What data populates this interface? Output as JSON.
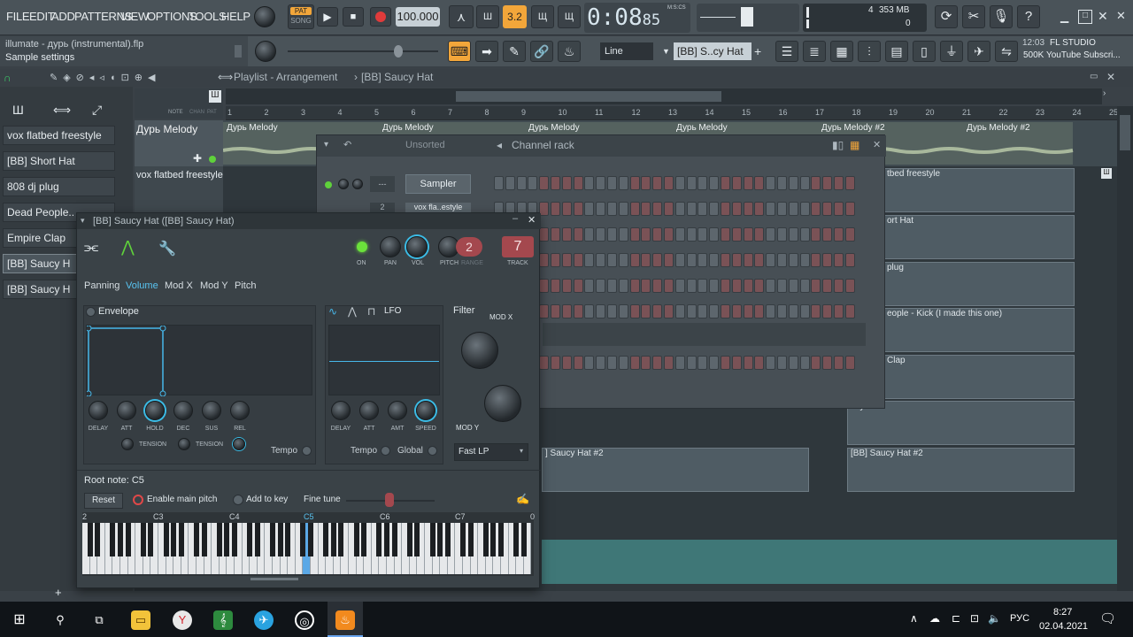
{
  "menu": [
    "FILE",
    "EDIT",
    "ADD",
    "PATTERNS",
    "VIEW",
    "OPTIONS",
    "TOOLS",
    "HELP"
  ],
  "pat_song": {
    "pat": "PAT",
    "song": "SONG"
  },
  "tempo": "100.000",
  "time": "0:08",
  "time_small": "85",
  "time_label": "M:S:CS",
  "pattern_num": "3.2",
  "cpu_value": "4",
  "memory": "353 MB",
  "polyphony": "0",
  "hint": {
    "line1": "illumate - дурь (instrumental).flp",
    "line2": "Sample settings"
  },
  "toolbar": {
    "snap": "Line",
    "channel": "[BB] S..cy Hat",
    "news": {
      "time": "12:03",
      "title": "FL STUDIO",
      "text": "500K YouTube Subscri..."
    }
  },
  "playlist": {
    "title": "Playlist - Arrangement",
    "pattern": "[BB] Saucy Hat"
  },
  "ruler_labels": [
    "NOTE",
    "CHAN",
    "PAT"
  ],
  "ruler": [
    "1",
    "2",
    "3",
    "4",
    "5",
    "6",
    "7",
    "8",
    "9",
    "10",
    "11",
    "12",
    "13",
    "14",
    "15",
    "16",
    "17",
    "18",
    "19",
    "20",
    "21",
    "22",
    "23",
    "24",
    "25"
  ],
  "picker": [
    "vox flatbed freestyle",
    "[BB] Short Hat",
    "808 dj plug",
    "Dead People..",
    "Empire Clap",
    "[BB] Saucy H",
    "[BB] Saucy H"
  ],
  "tracks": {
    "t1": "Дурь Melody",
    "t2": "vox flatbed freestyle"
  },
  "clips": {
    "melody": "Дурь Melody",
    "melody2": "Дурь Melody #2",
    "vox": "tbed freestyle",
    "short": "ort Hat",
    "plug": "plug",
    "dead": "eople - Kick (I made this one)",
    "clap": "Clap",
    "saucy": "ucy Hat",
    "saucy2a": "] Saucy Hat #2",
    "saucy2b": "[BB] Saucy Hat #2"
  },
  "channel_rack": {
    "title": "Channel rack",
    "sort": "Unsorted",
    "sampler": "Sampler",
    "ch2": "vox fla..estyle",
    "num": "---",
    "num2": "2"
  },
  "plugin": {
    "title": "[BB] Saucy Hat ([BB] Saucy Hat)",
    "labels": {
      "on": "ON",
      "pan": "PAN",
      "vol": "VOL",
      "pitch": "PITCH",
      "range": "RANGE",
      "track": "TRACK"
    },
    "range": "2",
    "track": "7",
    "tabs": [
      "Panning",
      "Volume",
      "Mod X",
      "Mod Y",
      "Pitch"
    ],
    "envelope": "Envelope",
    "env_knobs": [
      "DELAY",
      "ATT",
      "HOLD",
      "DEC",
      "SUS",
      "REL"
    ],
    "tension": "TENSION",
    "tempo": "Tempo",
    "lfo": "LFO",
    "lfo_knobs": [
      "DELAY",
      "ATT",
      "AMT",
      "SPEED"
    ],
    "global": "Global",
    "filter": "Filter",
    "modx": "MOD X",
    "mody": "MOD Y",
    "filter_type": "Fast LP",
    "root_note": "Root note: C5",
    "reset": "Reset",
    "enable_pitch": "Enable main pitch",
    "add_key": "Add to key",
    "fine_tune": "Fine tune",
    "octaves": [
      "2",
      "C3",
      "C4",
      "C5",
      "C6",
      "C7",
      "0"
    ]
  },
  "taskbar": {
    "lang": "РУС",
    "time": "8:27",
    "date": "02.04.2021"
  }
}
